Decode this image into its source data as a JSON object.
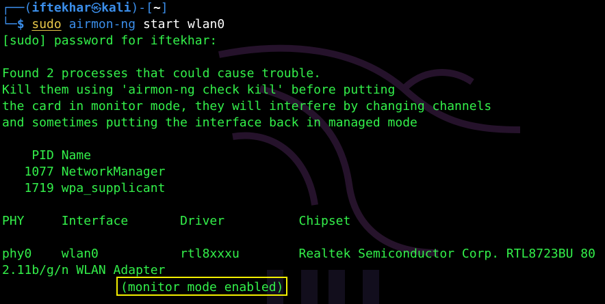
{
  "prompt": {
    "frame_top_left": "┌──(",
    "user": "iftekhar",
    "at_symbol": "㉿",
    "host": "kali",
    "frame_mid": ")-[",
    "path": "~",
    "frame_end": "]",
    "frame_bottom": "└─",
    "dollar": "$",
    "command_sudo": "sudo",
    "command_program": "airmon-ng",
    "command_args": "start wlan0"
  },
  "output": {
    "sudo_prompt": "[sudo] password for iftekhar:",
    "warning_1": "Found 2 processes that could cause trouble.",
    "warning_2": "Kill them using 'airmon-ng check kill' before putting",
    "warning_3": "the card in monitor mode, they will interfere by changing channels",
    "warning_4": "and sometimes putting the interface back in managed mode",
    "process_header": "    PID Name",
    "processes": [
      "   1077 NetworkManager",
      "   1719 wpa_supplicant"
    ],
    "table_header": "PHY     Interface       Driver          Chipset",
    "table_row": "phy0    wlan0           rtl8xxxu        Realtek Semiconductor Corp. RTL8723BU 80",
    "table_row_wrap": "2.11b/g/n WLAN Adapter",
    "status_message": "(monitor mode enabled)"
  },
  "colors": {
    "background": "#000000",
    "output_text": "#33f04a",
    "prompt_blue": "#3b8eea",
    "sudo_yellow": "#e8c84a",
    "highlight_box": "#f4f000"
  }
}
